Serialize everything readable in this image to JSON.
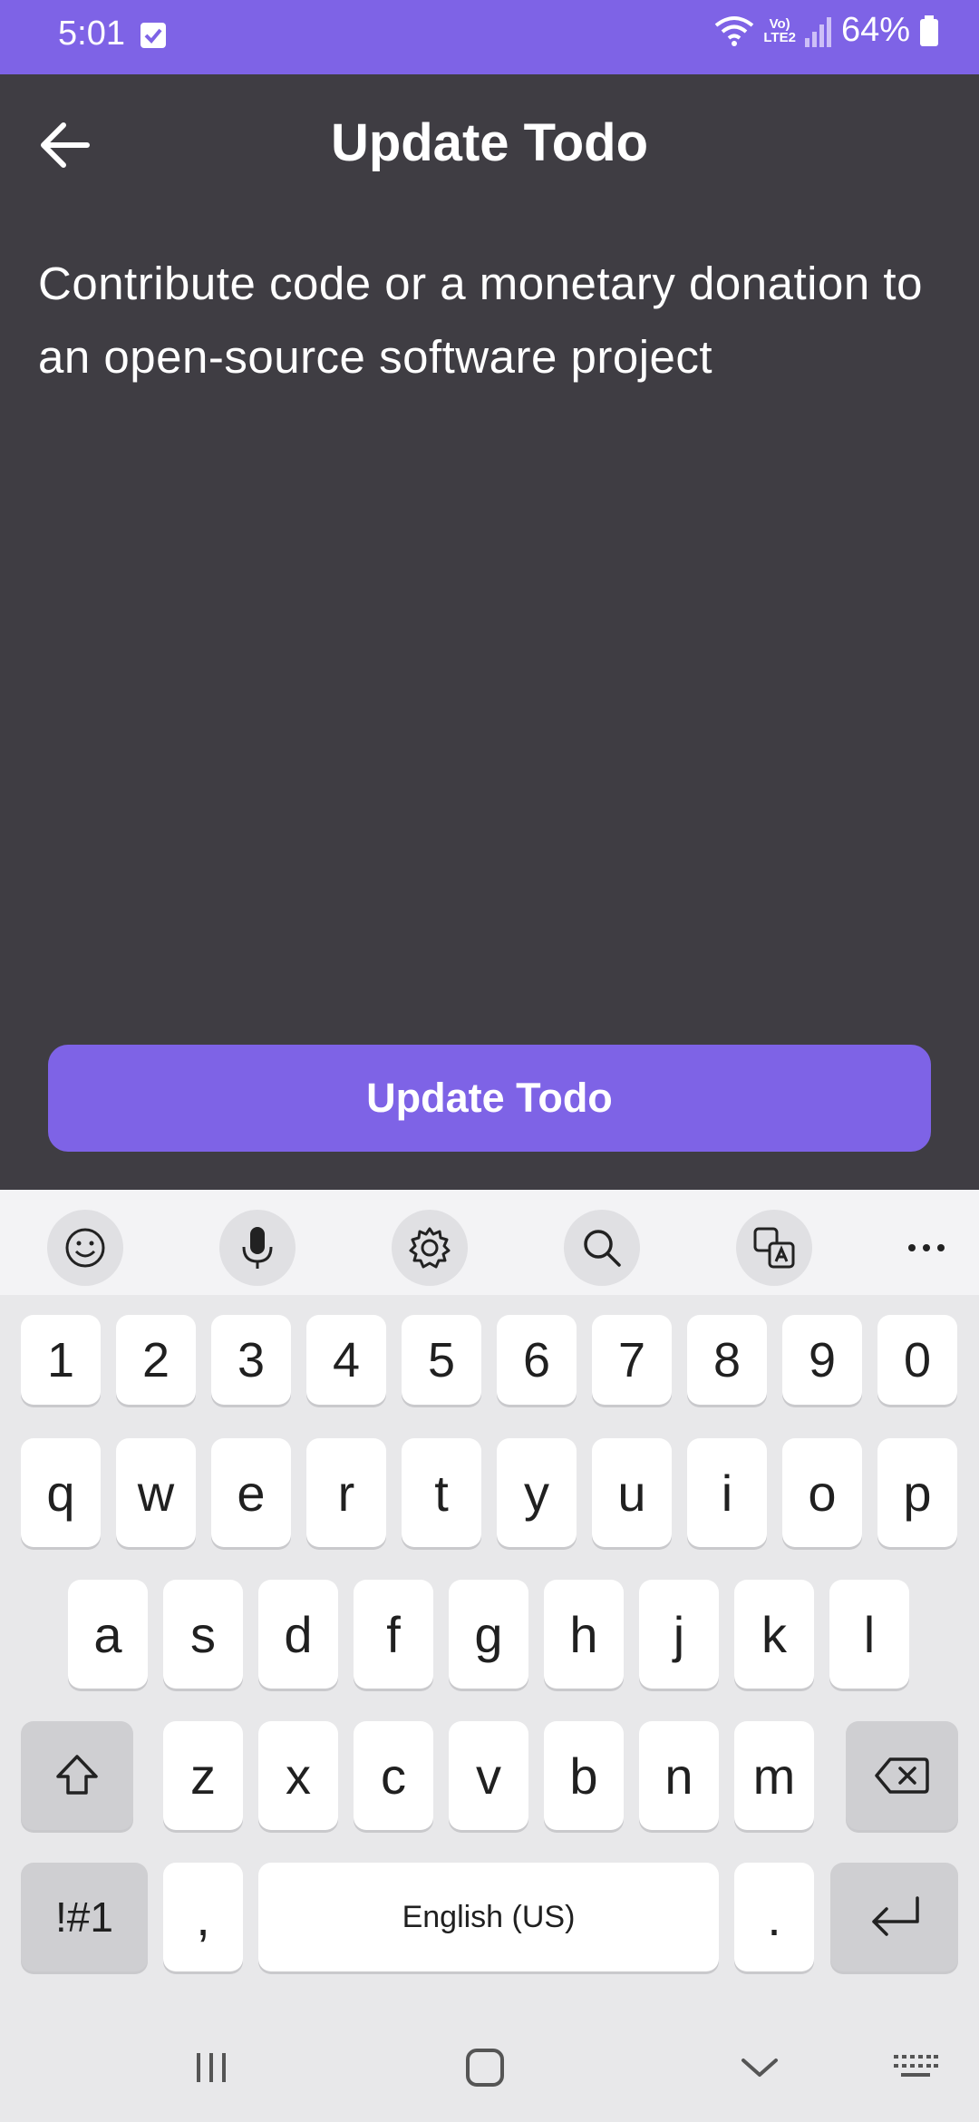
{
  "status_bar": {
    "time": "5:01",
    "network_label_top": "Vo)",
    "network_label_bottom": "LTE2",
    "battery_percent": "64%"
  },
  "app_bar": {
    "title": "Update Todo"
  },
  "todo": {
    "text": "Contribute code or a monetary donation to an open-source software project"
  },
  "actions": {
    "update_label": "Update Todo"
  },
  "keyboard": {
    "row_digits": [
      "1",
      "2",
      "3",
      "4",
      "5",
      "6",
      "7",
      "8",
      "9",
      "0"
    ],
    "row_1": [
      "q",
      "w",
      "e",
      "r",
      "t",
      "y",
      "u",
      "i",
      "o",
      "p"
    ],
    "row_2": [
      "a",
      "s",
      "d",
      "f",
      "g",
      "h",
      "j",
      "k",
      "l"
    ],
    "row_3": [
      "z",
      "x",
      "c",
      "v",
      "b",
      "n",
      "m"
    ],
    "symbols_label": "!#1",
    "comma_label": ",",
    "space_label": "English (US)",
    "period_label": "."
  },
  "colors": {
    "accent": "#7e63e6",
    "background": "#3f3d43",
    "keyboard_bg": "#e8e8ea"
  }
}
